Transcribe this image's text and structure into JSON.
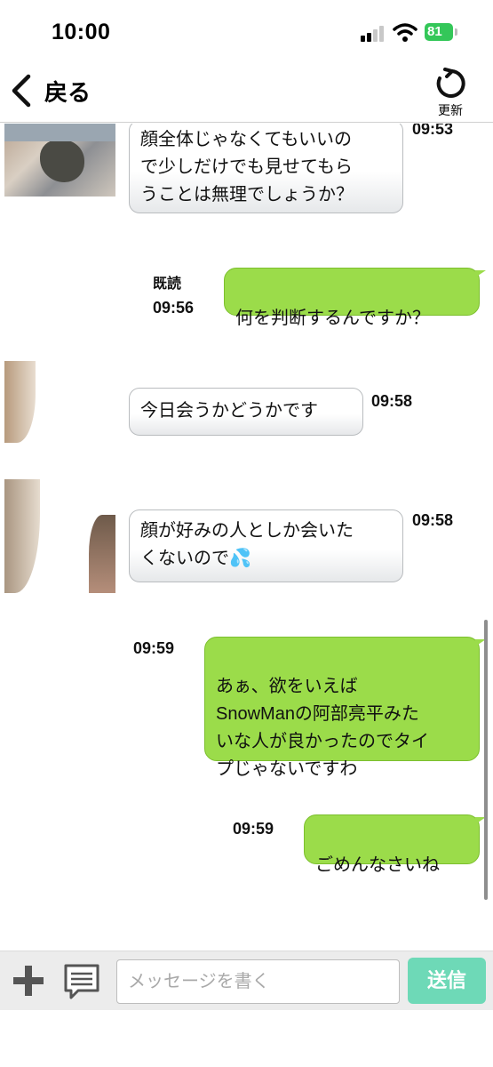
{
  "status_bar": {
    "time": "10:00",
    "battery": "81"
  },
  "header": {
    "back_label": "戻る",
    "refresh_label": "更新"
  },
  "messages": [
    {
      "direction": "in",
      "text": "顔全体じゃなくてもいいの\nで少しだけでも見せてもら\nうことは無理でしょうか？",
      "time": "09:53"
    },
    {
      "direction": "out",
      "text": "何を判断するんですか？",
      "time": "09:56",
      "read": "既読"
    },
    {
      "direction": "in",
      "text": "今日会うかどうかです",
      "time": "09:58"
    },
    {
      "direction": "in",
      "text": "顔が好みの人としか会いた\nくないので💦",
      "time": "09:58"
    },
    {
      "direction": "out",
      "text": "あぁ、欲をいえば\nSnowManの阿部亮平みた\nいな人が良かったのでタイ\nプじゃないですわ",
      "time": "09:59"
    },
    {
      "direction": "out",
      "text": "ごめんなさいね",
      "time": "09:59"
    }
  ],
  "input_bar": {
    "placeholder": "メッセージを書く",
    "send_label": "送信"
  },
  "colors": {
    "outgoing_bubble": "#9bdc4a",
    "send_button": "#6ed9b7",
    "battery": "#34c759"
  },
  "icons": [
    "back-chevron-icon",
    "refresh-icon",
    "plus-icon",
    "memo-icon",
    "wifi-icon",
    "signal-icon"
  ]
}
